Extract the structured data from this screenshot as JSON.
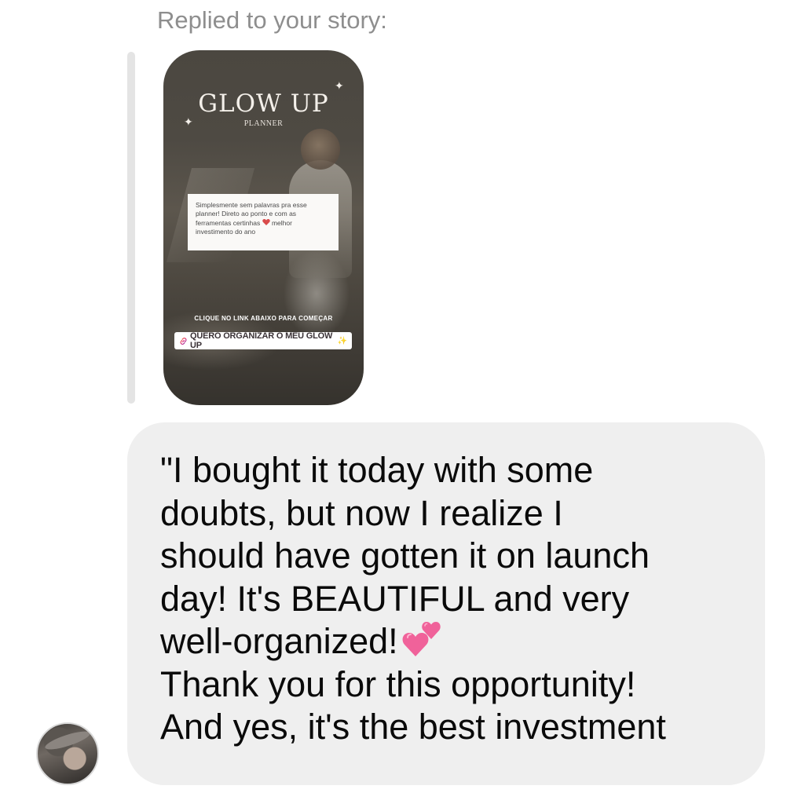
{
  "reply_header": {
    "label": "Replied to your story:"
  },
  "story": {
    "title": "GLOW UP",
    "subtitle": "PLANNER",
    "review_lines": [
      "Simplesmente sem palavras pra esse",
      "planner! Direto ao ponto e com as",
      "ferramentas certinhas",
      "melhor",
      "investimento do ano"
    ],
    "cta_text": "CLIQUE NO LINK ABAIXO PARA COMEÇAR",
    "link_sticker_text": "QUERO ORGANIZAR O MEU GLOW UP",
    "icons": {
      "sparkle": "sparkle-icon",
      "heart": "heart-icon",
      "link": "link-icon"
    }
  },
  "message": {
    "lines": [
      "\"I bought it today with some",
      "doubts, but now I realize I",
      "should have gotten it on launch",
      "day! It's BEAUTIFUL and very",
      "well-organized!",
      "Thank you for this opportunity!",
      "And yes, it's the best investment"
    ],
    "emoji": "two-hearts-emoji",
    "bubble_color": "#efefef",
    "text_color": "#0a0a0a"
  },
  "sender": {
    "avatar": "avatar"
  },
  "colors": {
    "header_text": "#8e8e8e",
    "reply_bar": "#e4e4e4",
    "heart_emoji": "#f0629a"
  }
}
